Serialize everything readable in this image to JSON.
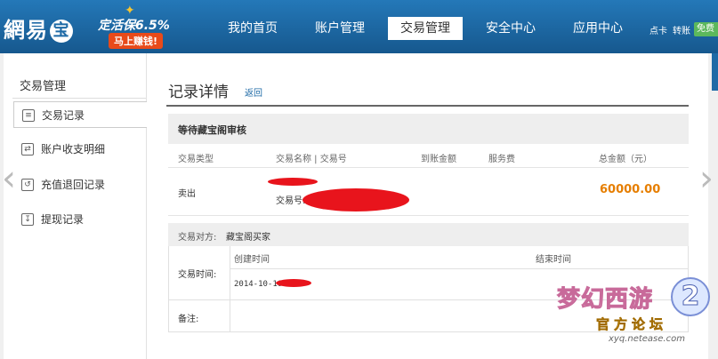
{
  "header": {
    "logo_text": "網易",
    "logo_circle": "宝",
    "promo_line1": "定活保6.5%",
    "promo_line2": "马上赚钱!",
    "nav": [
      "我的首页",
      "账户管理",
      "交易管理",
      "安全中心",
      "应用中心"
    ],
    "active_nav": "交易管理",
    "toplinks": [
      "点卡",
      "转账"
    ],
    "top_button": "免费"
  },
  "sidebar": {
    "title": "交易管理",
    "items": [
      {
        "label": "交易记录",
        "icon": "list-icon"
      },
      {
        "label": "账户收支明细",
        "icon": "transfer-icon"
      },
      {
        "label": "充值退回记录",
        "icon": "refund-icon"
      },
      {
        "label": "提现记录",
        "icon": "withdraw-icon"
      }
    ]
  },
  "detail": {
    "title": "记录详情",
    "back": "返回",
    "status": "等待藏宝阁审核",
    "columns": [
      "交易类型",
      "交易名称 | 交易号",
      "到账金额",
      "服务费",
      "总金额（元）"
    ],
    "row": {
      "type": "卖出",
      "trade_no_label": "交易号:",
      "total": "60000.00"
    },
    "counterparty_label": "交易对方:",
    "counterparty": "藏宝阁买家",
    "time_label": "交易时间:",
    "created_label": "创建时间",
    "ended_label": "结束时间",
    "created_value": "2014-10-10",
    "remark_label": "备注:"
  },
  "watermark": {
    "title": "梦幻西游",
    "number": "2",
    "subtitle": "官方论坛",
    "url": "xyq.netease.com"
  },
  "colors": {
    "header": "#1e6aa6",
    "amount": "#e67e00",
    "redaction": "#e8141c"
  }
}
